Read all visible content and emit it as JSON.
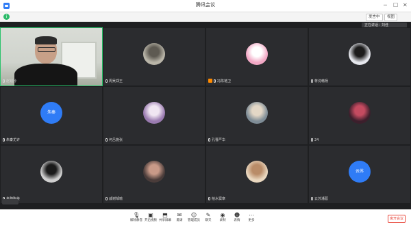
{
  "window": {
    "title": "腾讯会议",
    "controls": [
      "─",
      "☐",
      "✕"
    ]
  },
  "subbar": {
    "speaking_label": "发言中",
    "layout_label": "视图"
  },
  "notice": "正在讲话：刘佳",
  "tiles": [
    {
      "name": "赵钱孙",
      "type": "camera",
      "active": true
    },
    {
      "name": "周吴郑王",
      "type": "photo",
      "colors": [
        "#b9b5a8",
        "#5e5a52"
      ]
    },
    {
      "name": "冯陈褚卫",
      "type": "photo",
      "host": true,
      "colors": [
        "#f2a8c5",
        "#ffffff"
      ]
    },
    {
      "name": "蒋沈韩杨",
      "type": "photo",
      "colors": [
        "#e6e8ee",
        "#1c1c1c"
      ]
    },
    {
      "name": "朱秦尤许",
      "type": "text",
      "avatar_text": "朱秦"
    },
    {
      "name": "何吕施张",
      "type": "photo",
      "colors": [
        "#9a7bb0",
        "#f0e6f2"
      ]
    },
    {
      "name": "孔曹严华",
      "type": "photo",
      "colors": [
        "#7f8d97",
        "#e3d7c6"
      ]
    },
    {
      "name": "24",
      "type": "photo",
      "colors": [
        "#3c1f2c",
        "#c44b60"
      ]
    },
    {
      "name": "金魏陶姜",
      "type": "photo",
      "colors": [
        "#cfcfcf",
        "#1a1a1a"
      ]
    },
    {
      "name": "戚谢邹喻",
      "type": "photo",
      "colors": [
        "#4a3c3a",
        "#c99a88"
      ]
    },
    {
      "name": "柏水窦章",
      "type": "photo",
      "colors": [
        "#e9d7bf",
        "#b98c68"
      ]
    },
    {
      "name": "云苏潘葛",
      "type": "text",
      "avatar_text": "云苏"
    }
  ],
  "toolbar": {
    "items": [
      {
        "label": "解除静音",
        "icon": "mic-icon"
      },
      {
        "label": "开启视频",
        "icon": "camera-icon"
      },
      {
        "label": "共享屏幕",
        "icon": "screen-share-icon"
      },
      {
        "label": "邀请",
        "icon": "invite-icon"
      },
      {
        "label": "管理成员",
        "icon": "members-icon"
      },
      {
        "label": "聊天",
        "icon": "chat-icon"
      },
      {
        "label": "录制",
        "icon": "record-icon"
      },
      {
        "label": "表情",
        "icon": "emoji-icon"
      },
      {
        "label": "更多",
        "icon": "more-icon"
      }
    ],
    "end_label": "离开会议"
  }
}
